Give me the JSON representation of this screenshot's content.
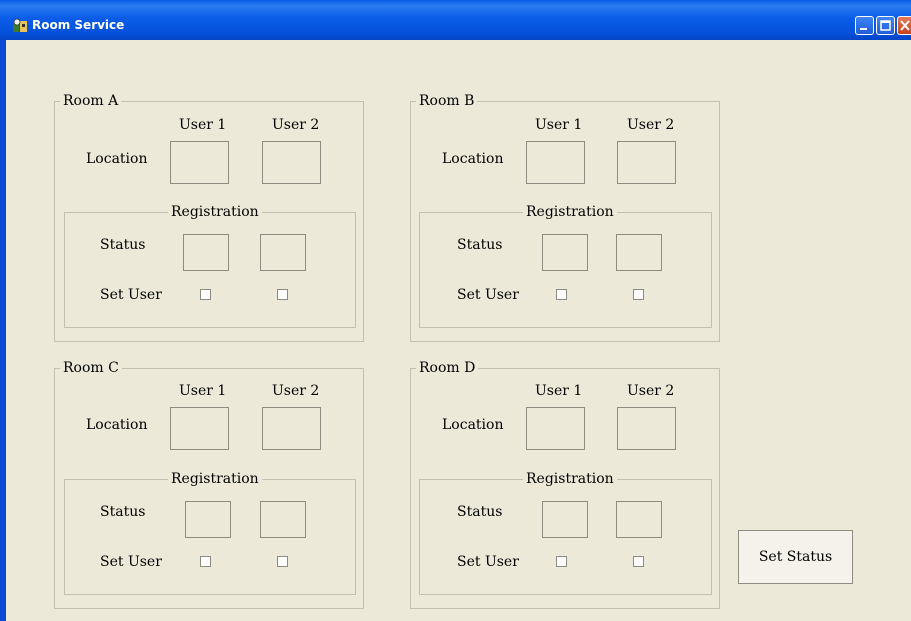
{
  "window": {
    "title": "Room Service"
  },
  "labels": {
    "user1": "User 1",
    "user2": "User 2",
    "location": "Location",
    "registration": "Registration",
    "status": "Status",
    "set_user": "Set User"
  },
  "rooms": [
    {
      "name": "Room A"
    },
    {
      "name": "Room B"
    },
    {
      "name": "Room C"
    },
    {
      "name": "Room D"
    }
  ],
  "buttons": {
    "set_status": "Set Status"
  },
  "icons": {
    "app": "app-icon",
    "minimize": "minimize-icon",
    "maximize": "maximize-icon",
    "close": "close-icon"
  }
}
